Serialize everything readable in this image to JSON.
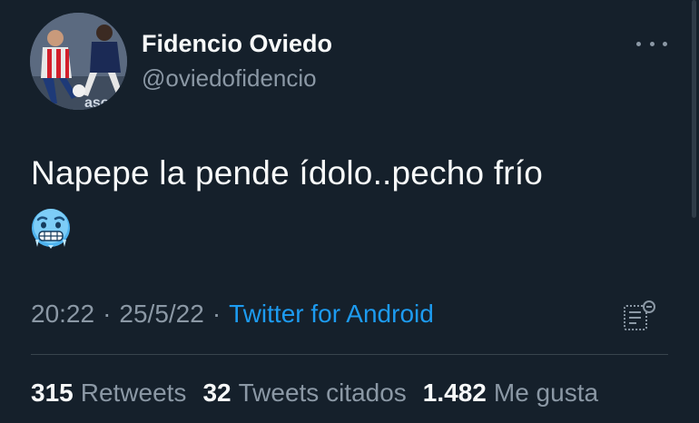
{
  "author": {
    "display_name": "Fidencio Oviedo",
    "handle": "@oviedofidencio",
    "avatar_icon": "profile-photo"
  },
  "tweet": {
    "text": "Napepe la pende ídolo..pecho frío",
    "emoji_icon": "cold-face-emoji",
    "time": "20:22",
    "date": "25/5/22",
    "separator": "·",
    "source": "Twitter for Android"
  },
  "stats": {
    "retweets_count": "315",
    "retweets_label": "Retweets",
    "quotes_count": "32",
    "quotes_label": "Tweets citados",
    "likes_count": "1.482",
    "likes_label": "Me gusta"
  },
  "colors": {
    "background": "#15202b",
    "text_primary": "#f7f9f9",
    "text_secondary": "#8b98a5",
    "accent": "#1d9bf0",
    "divider": "#38444d"
  }
}
